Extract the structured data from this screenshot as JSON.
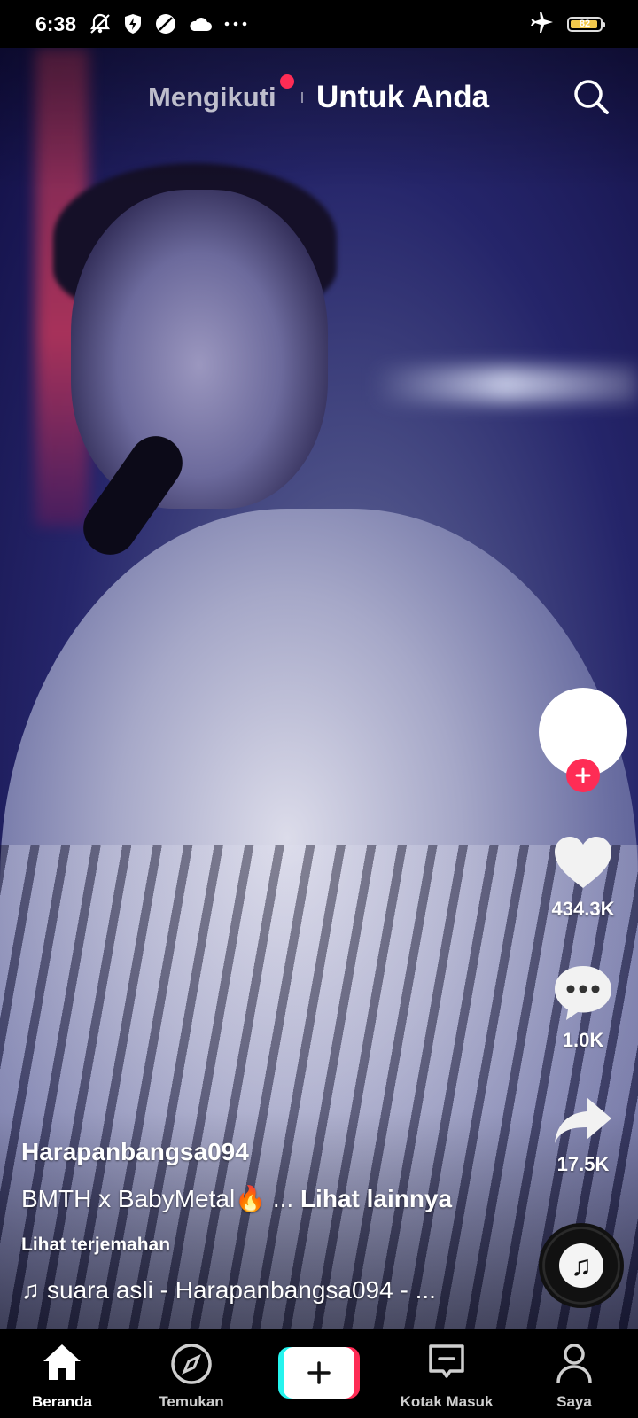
{
  "status_bar": {
    "time": "6:38",
    "battery": "82",
    "icons": [
      "bell-muted-icon",
      "shield-bolt-icon",
      "circle-slash-icon",
      "cloud-icon",
      "more-dots-icon",
      "airplane-icon",
      "battery-icon"
    ]
  },
  "top_tabs": {
    "following": "Mengikuti",
    "for_you": "Untuk Anda",
    "notification_color": "#fe2c55",
    "search_icon": "search-icon"
  },
  "actions": {
    "likes": "434.3K",
    "comments": "1.0K",
    "shares": "17.5K"
  },
  "caption": {
    "username": "Harapanbangsa094",
    "description": "BMTH x BabyMetal🔥",
    "more_prefix": "...",
    "see_more": "Lihat lainnya",
    "translate": "Lihat terjemahan",
    "sound_icon": "♫",
    "sound": "suara asli - Harapanbangsa094 - ..."
  },
  "bottom_nav": {
    "home": "Beranda",
    "discover": "Temukan",
    "inbox": "Kotak Masuk",
    "profile": "Saya"
  },
  "colors": {
    "accent": "#fe2c55",
    "cyan": "#25f4ee"
  }
}
